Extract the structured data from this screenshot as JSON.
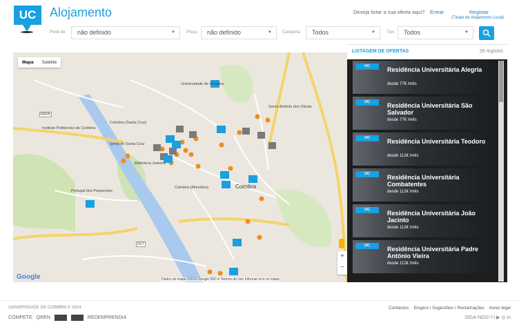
{
  "header": {
    "logo_text": "UC",
    "title": "Alojamento",
    "offer_prompt": "Deseja listar a sua oferta aqui?",
    "login": "Entrar",
    "register": "Registar",
    "register_sub": "(Titular de Alojamento Local)"
  },
  "filters": {
    "perto_label": "Perto de",
    "perto_value": "não definido",
    "preco_label": "Preço",
    "preco_value": "não definido",
    "categoria_label": "Categoria",
    "categoria_value": "Todos",
    "tipo_label": "Tipo",
    "tipo_value": "Todos"
  },
  "map": {
    "tab_map": "Mapa",
    "tab_satellite": "Satélite",
    "google": "Google",
    "footer": "Dados do mapa ©2016 Google   500 m        Termos de Uso     Informar erro no mapa",
    "zoom_in": "+",
    "zoom_out": "−",
    "labels": {
      "coimbra": "Coimbra",
      "coimbra_almedina": "Coimbra (Almedina)",
      "coimbra_santa_cruz": "Coimbra (Santa Cruz)",
      "santo_antonio": "Santo António dos Olivais",
      "universidade": "Universidade de Coimbra",
      "instituto": "Instituto Politécnico de Coimbra",
      "igreja": "Igreja de Santa Cruz",
      "biblioteca": "Biblioteca Joanina",
      "portugal_pequenitos": "Portugal dos Pequenitos",
      "m605": "M605",
      "n17": "N17"
    },
    "pin_label": "UC"
  },
  "listing": {
    "title": "LISTAGEM DE OFERTAS",
    "count": "28 registos",
    "offers": [
      {
        "tag": "UC",
        "name": "Residência Universitária Alegria",
        "price": "desde 77€ /mês"
      },
      {
        "tag": "UC",
        "name": "Residência Universitária São Salvador",
        "price": "desde 77€ /mês"
      },
      {
        "tag": "UC",
        "name": "Residência Universitária Teodoro",
        "price": "desde 112€ /mês"
      },
      {
        "tag": "UC",
        "name": "Residência Universitária Combatentes",
        "price": "desde 112€ /mês"
      },
      {
        "tag": "UC",
        "name": "Residência Universitária João Jacinto",
        "price": "desde 112€ /mês"
      },
      {
        "tag": "UC",
        "name": "Residência Universitária Padre António Vieira",
        "price": "desde 112€ /mês"
      }
    ]
  },
  "footer": {
    "copyright": "UNIVERSIDADE DE COIMBRA © 2014",
    "contactos": "Contactos",
    "elogios": "Elogios / Sugestões / Reclamações",
    "aviso": "Aviso legal",
    "siga": "SIGA-NOS!",
    "partners": [
      "COMPETE",
      "QREN",
      "REDEMPRENDIA"
    ]
  },
  "colors": {
    "accent": "#1a9fe0",
    "pin_orange": "#f08c1e"
  }
}
